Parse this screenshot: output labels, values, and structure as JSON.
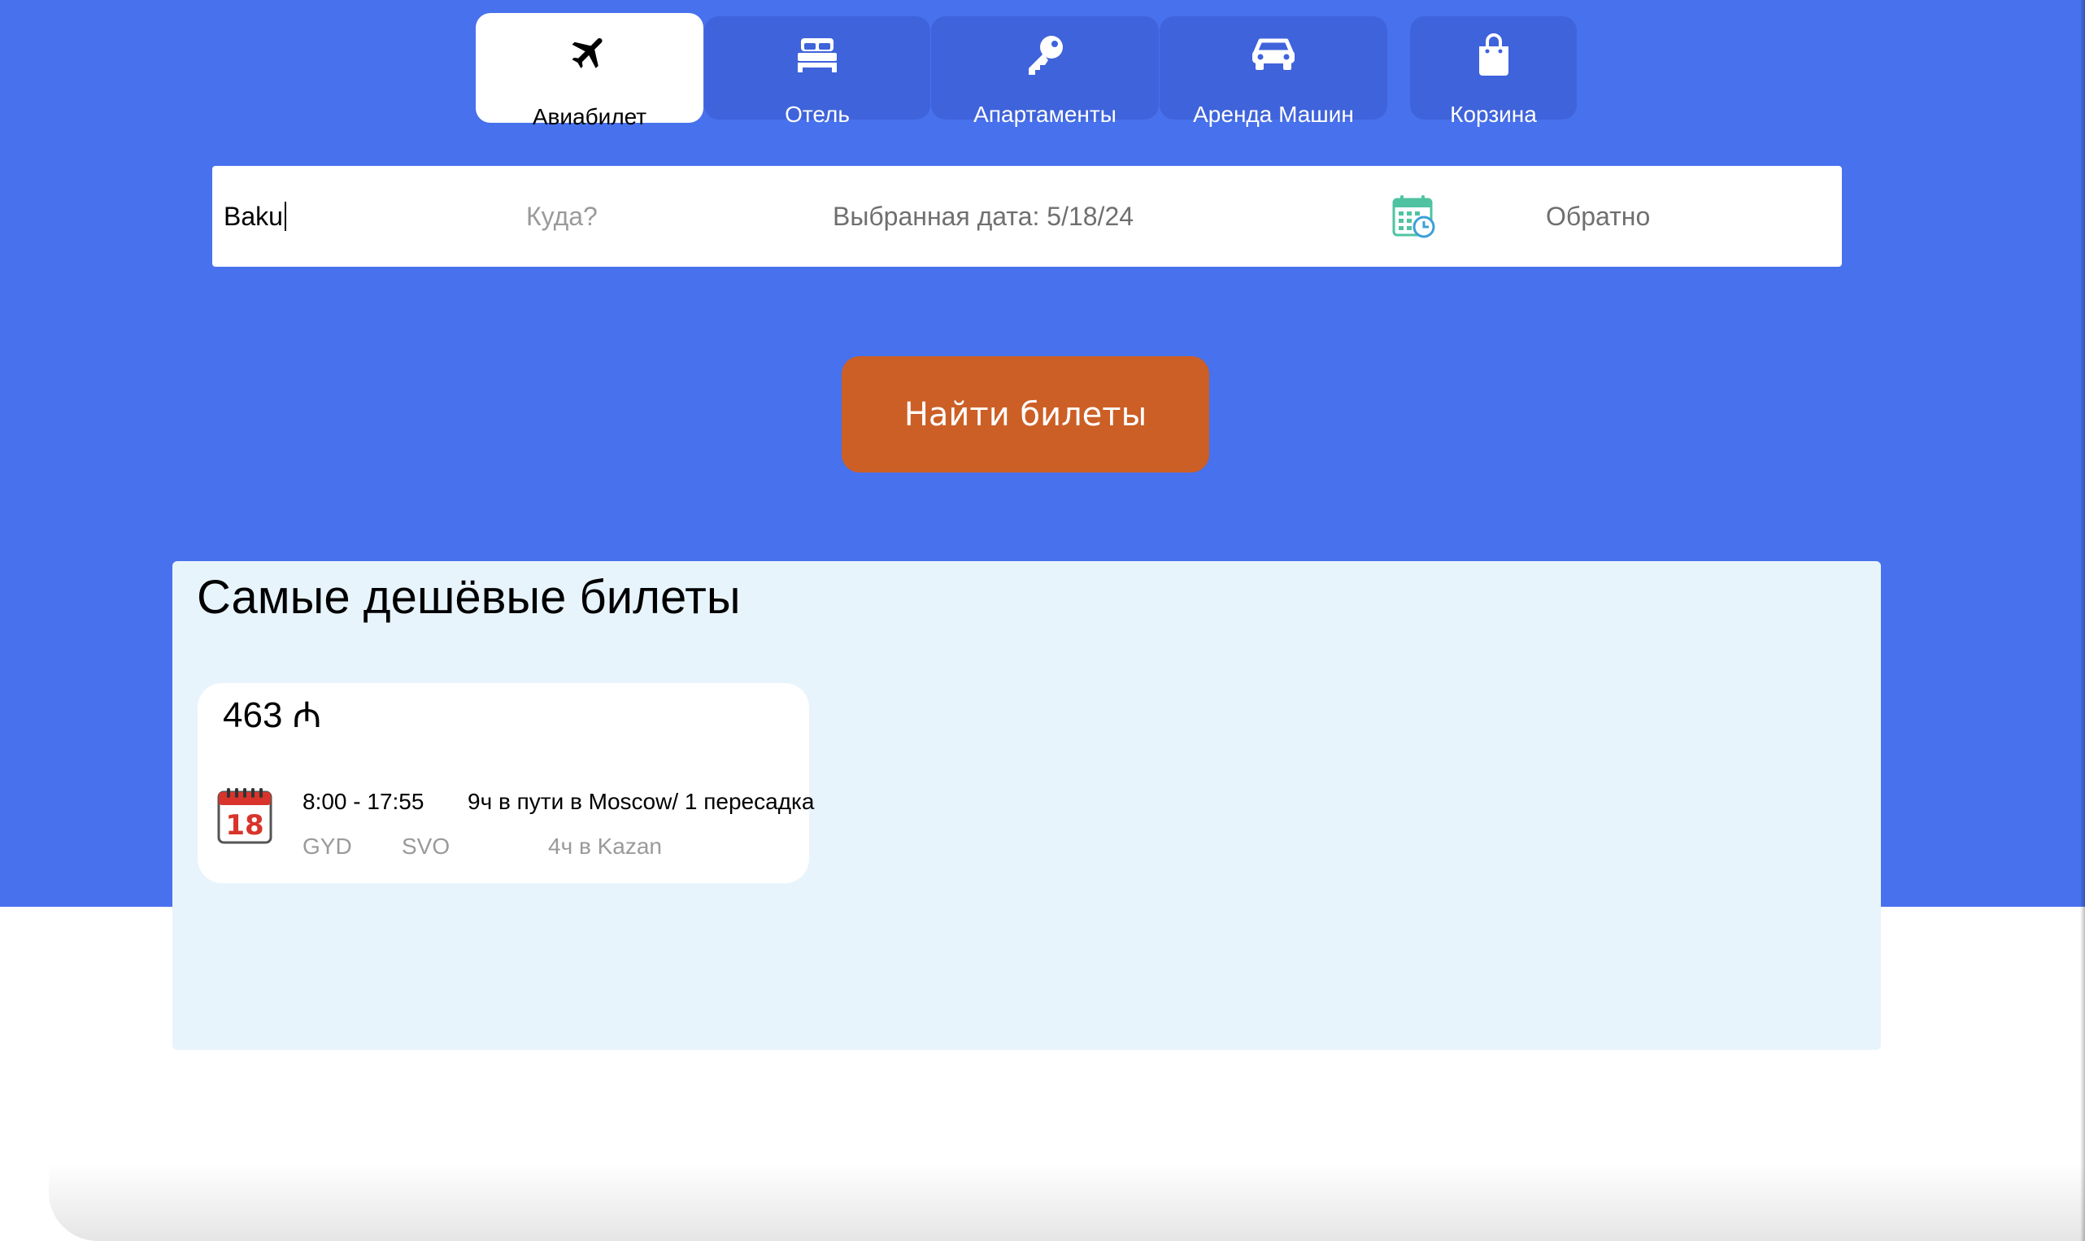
{
  "tabs": [
    {
      "label": "Авиабилет",
      "icon": "airplane-icon",
      "active": true
    },
    {
      "label": "Отель",
      "icon": "bed-icon",
      "active": false
    },
    {
      "label": "Апартаменты",
      "icon": "key-icon",
      "active": false
    },
    {
      "label": "Аренда Машин",
      "icon": "car-icon",
      "active": false
    },
    {
      "label": "Корзина",
      "icon": "shopping-bag-icon",
      "active": false
    }
  ],
  "search": {
    "from_value": "Baku",
    "to_placeholder": "Куда?",
    "date_text": "Выбранная дата: 5/18/24",
    "calendar_icon": "calendar-clock-icon",
    "return_label": "Обратно"
  },
  "find_button": {
    "label": "Найти билеты"
  },
  "results": {
    "title": "Самые дешёвые билеты",
    "tickets": [
      {
        "price": "463 ₼",
        "date_icon": "calendar-icon",
        "date_day": "18",
        "time": "8:00 - 17:55",
        "duration": "9ч в пути в Moscow/ 1 пересадка",
        "from_code": "GYD",
        "to_code": "SVO",
        "stopover": "4ч в Kazan"
      }
    ]
  },
  "colors": {
    "hero_bg": "#4771ED",
    "tab_bg": "#3F63DB",
    "button_bg": "#CC5F26",
    "panel_bg": "#E8F4FC"
  }
}
